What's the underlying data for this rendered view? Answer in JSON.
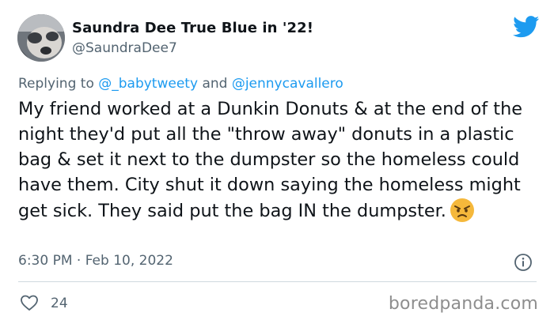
{
  "tweet": {
    "author": {
      "display_name": "Saundra Dee True Blue in '22!",
      "handle": "@SaundraDee7",
      "avatar_icon": "profile-photo"
    },
    "reply": {
      "prefix": "Replying to",
      "mention_1": "@_babytweety",
      "joiner": "and",
      "mention_2": "@jennycavallero"
    },
    "text": "My friend worked at a Dunkin Donuts & at the end of the night they'd put all the \"throw away\" donuts in a plastic bag & set it next to the dumpster so the homeless could have  them. City shut it down saying the homeless might get sick. They said put the bag IN the dumpster.",
    "emoji": "angry-face-emoji",
    "timestamp": "6:30 PM · Feb 10, 2022",
    "likes": "24"
  },
  "icons": {
    "brand": "twitter-bird-icon",
    "info": "info-icon",
    "like": "heart-icon"
  },
  "colors": {
    "twitter_blue": "#1d9bf0",
    "secondary_text": "#536471",
    "primary_text": "#0f1419",
    "watermark": "#8e8e8e"
  },
  "watermark": "boredpanda.com"
}
